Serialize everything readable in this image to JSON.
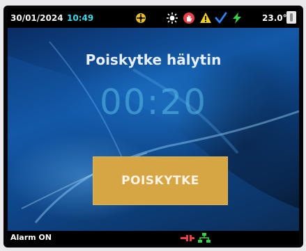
{
  "status_bar": {
    "date": "30/01/2024",
    "time": "10:49",
    "temperature": "23.0°C",
    "icons": [
      "network-badge-icon",
      "sun-icon",
      "hand-alert-icon",
      "warning-triangle-icon",
      "checkmark-icon",
      "lightning-icon",
      "thermometer-icon"
    ],
    "colors": {
      "time": "#3fd6e6",
      "warning": "#f0d020",
      "check": "#2e86ff",
      "lightning": "#36d24a",
      "hand": "#e8404a"
    }
  },
  "main": {
    "title": "Poiskytke hälytin",
    "countdown": "00:20",
    "button_label": "POISKYTKE",
    "button_color": "#d7a644"
  },
  "footer": {
    "status": "Alarm ON",
    "icons": [
      "plug-disconnected-icon",
      "network-tree-icon"
    ]
  }
}
